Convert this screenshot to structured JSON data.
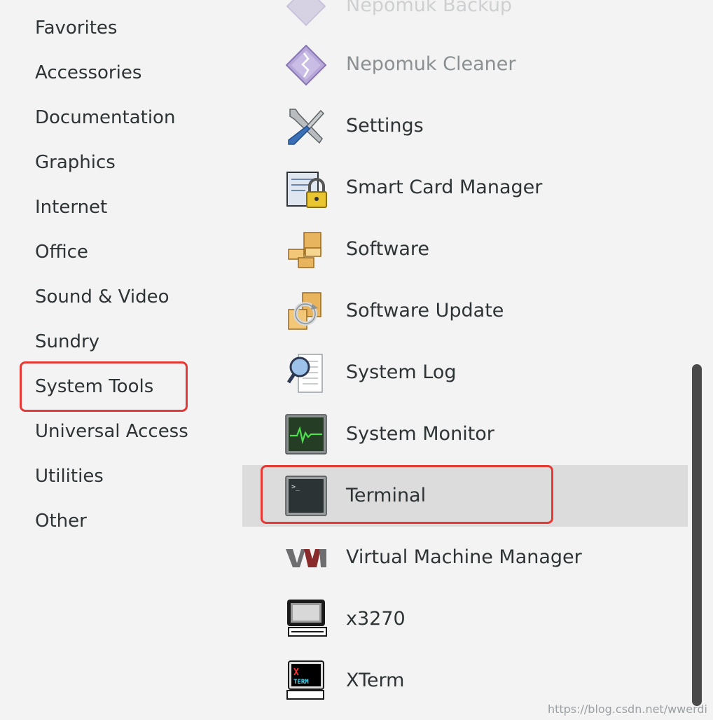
{
  "categories": [
    {
      "label": "Favorites"
    },
    {
      "label": "Accessories"
    },
    {
      "label": "Documentation"
    },
    {
      "label": "Graphics"
    },
    {
      "label": "Internet"
    },
    {
      "label": "Office"
    },
    {
      "label": "Sound & Video"
    },
    {
      "label": "Sundry"
    },
    {
      "label": "System Tools",
      "selected": true
    },
    {
      "label": "Universal Access"
    },
    {
      "label": "Utilities"
    },
    {
      "label": "Other"
    }
  ],
  "apps": [
    {
      "label": "Nepomuk Backup",
      "icon": "nepomuk-icon"
    },
    {
      "label": "Nepomuk Cleaner",
      "icon": "nepomuk-icon"
    },
    {
      "label": "Settings",
      "icon": "settings-tools-icon"
    },
    {
      "label": "Smart Card Manager",
      "icon": "smart-card-lock-icon"
    },
    {
      "label": "Software",
      "icon": "software-packages-icon"
    },
    {
      "label": "Software Update",
      "icon": "software-update-icon"
    },
    {
      "label": "System Log",
      "icon": "system-log-magnifier-icon"
    },
    {
      "label": "System Monitor",
      "icon": "system-monitor-icon"
    },
    {
      "label": "Terminal",
      "icon": "terminal-icon",
      "selected": true
    },
    {
      "label": "Virtual Machine Manager",
      "icon": "vmm-logo-icon"
    },
    {
      "label": "x3270",
      "icon": "x3270-terminal-icon"
    },
    {
      "label": "XTerm",
      "icon": "xterm-icon"
    }
  ],
  "colors": {
    "highlight": "#e53935",
    "selected_row": "#dcdcdc",
    "background": "#f3f3f3"
  },
  "watermark": "https://blog.csdn.net/wwerdi"
}
